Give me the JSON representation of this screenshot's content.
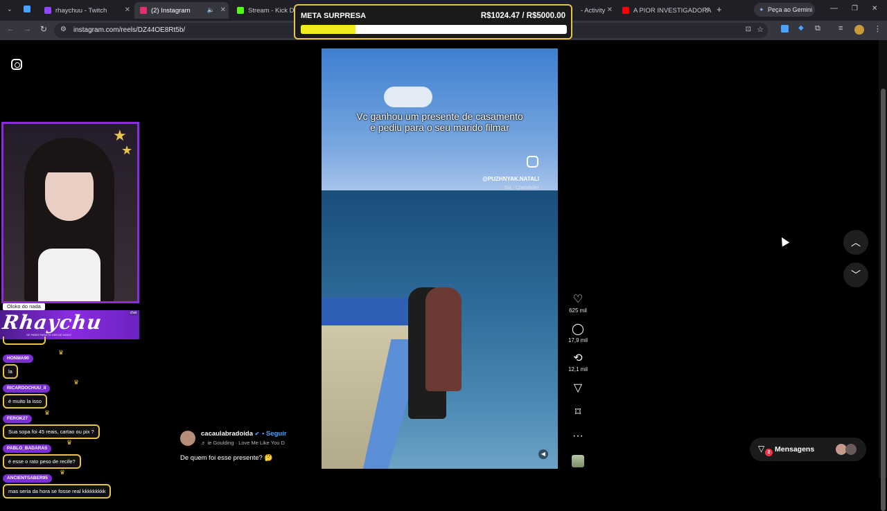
{
  "browser": {
    "tabs": [
      {
        "title": "rhaychuu - Twitch",
        "color": "#9146ff"
      },
      {
        "title": "(2) Instagram",
        "color": "#e1306c"
      },
      {
        "title": "Stream - Kick Dash",
        "color": "#53fc18"
      },
      {
        "title": "- Activity",
        "color": "#888888"
      },
      {
        "title": "A PIOR INVESTIGADORA",
        "color": "#ff0000"
      }
    ],
    "gemini_label": "Peça ao Gemini",
    "url": "instagram.com/reels/DZ44OE8Rt5b/"
  },
  "goal_overlay": {
    "label": "META SURPRESA",
    "amount": "R$1024.47 / R$5000.00",
    "progress": 0.2049
  },
  "reel": {
    "caption_line1": "Vc ganhou um presente de casamento",
    "caption_line2": "e pediu para o seu marido filmar",
    "watermark_handle": "@PUZHNYAK.NATALI",
    "watermark_song": "Sia · Chandelier",
    "actions": [
      {
        "name": "like",
        "icon": "♡",
        "count": "625 mil"
      },
      {
        "name": "comment",
        "icon": "◯",
        "count": "17,9 mil"
      },
      {
        "name": "repost",
        "icon": "⟲",
        "count": "12,1 mil"
      },
      {
        "name": "share",
        "icon": "▽",
        "count": ""
      },
      {
        "name": "save",
        "icon": "⌑",
        "count": ""
      },
      {
        "name": "more",
        "icon": "···",
        "count": ""
      }
    ],
    "author": "cacaulabradoida",
    "verified": "✔",
    "follow_label": "• Seguir",
    "song": "♬  ie Goulding · Love Me Like You D",
    "post_caption": "De quem foi esse presente? 🤔",
    "messages_label": "Mensagens",
    "messages_badge": "2"
  },
  "stream_overlay": {
    "alert_tag": "Oloko do nada",
    "banner_name": "Rhaychu",
    "banner_sub": "SE PAREI PARA TE VER DE NOVO",
    "banner_chat": "chat",
    "chat": [
      {
        "user": "HONMA90",
        "text": "la"
      },
      {
        "user": "RICARDOCHUU_II",
        "text": "é muito la isso"
      },
      {
        "user": "FEROK27",
        "text": "Sua sopa foi 45 reais, cartao ou pix ?"
      },
      {
        "user": "PABLO_BADARAS",
        "text": "é esse o rato peso de recife?"
      },
      {
        "user": "ANCIENTSABER95",
        "text": "mas seria da hora se fosse real kkkkkkkkk"
      }
    ]
  }
}
